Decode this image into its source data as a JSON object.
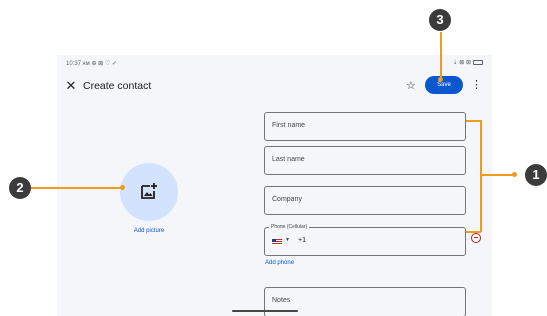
{
  "status_bar": {
    "time": "10:37 ᴀᴍ ⊕ ⊠ ♡ ✓",
    "icons_right": "⇣ ⊠ ⊠"
  },
  "app_bar": {
    "title": "Create contact",
    "save_label": "Save"
  },
  "photo": {
    "add_label": "Add picture"
  },
  "fields": {
    "first_name_placeholder": "First name",
    "last_name_placeholder": "Last name",
    "company_placeholder": "Company",
    "phone_label": "Phone (Cellular)",
    "phone_prefix": "+1",
    "notes_placeholder": "Notes"
  },
  "add_phone_label": "Add phone",
  "callouts": {
    "one": "1",
    "two": "2",
    "three": "3"
  },
  "colors": {
    "accent": "#0b57d0",
    "callout": "#f29a1d",
    "badge": "#3b3b3b",
    "avatar_bg": "#d3e3fd",
    "remove": "#b3261e"
  },
  "icons": [
    "close-icon",
    "star-icon",
    "more-vert-icon",
    "add-photo-icon",
    "us-flag-icon",
    "remove-circle-icon"
  ]
}
